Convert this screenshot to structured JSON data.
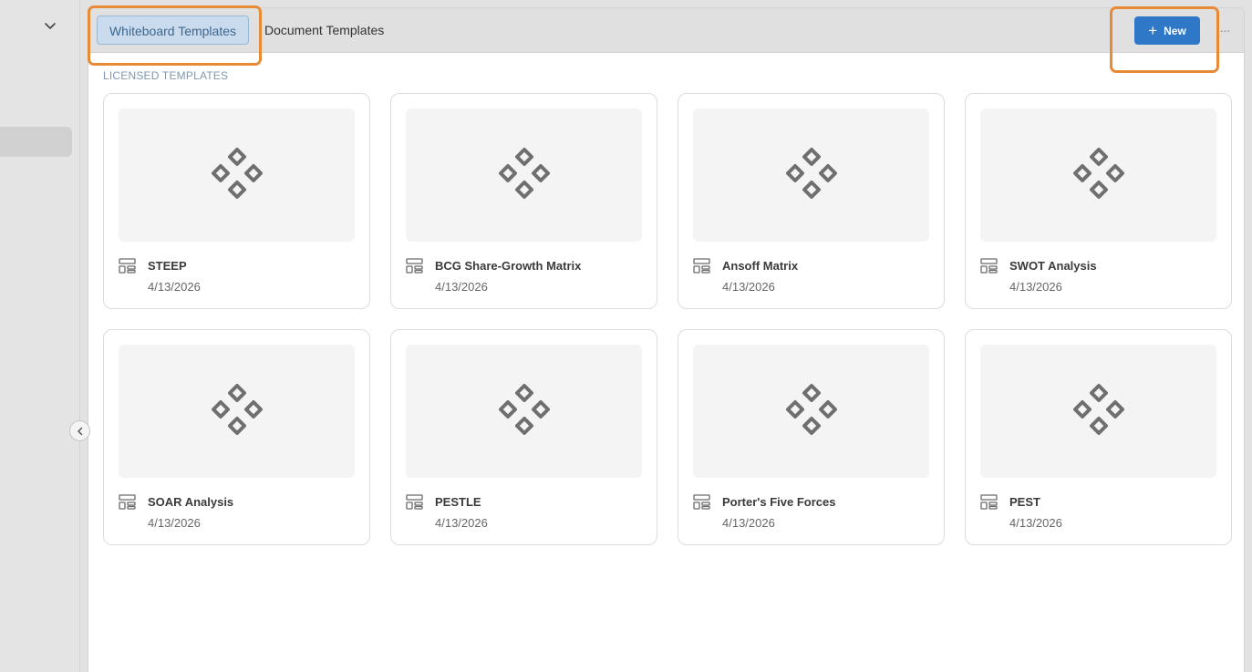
{
  "tabs": [
    {
      "label": "Whiteboard Templates",
      "active": true
    },
    {
      "label": "Document Templates",
      "active": false
    }
  ],
  "toolbar": {
    "new_label": "New",
    "new_icon": "plus-icon",
    "more_icon": "ellipsis-icon",
    "more_label": "···"
  },
  "section": {
    "label": "LICENSED TEMPLATES"
  },
  "templates": [
    {
      "title": "STEEP",
      "date": "4/13/2026"
    },
    {
      "title": "BCG Share-Growth Matrix",
      "date": "4/13/2026"
    },
    {
      "title": "Ansoff Matrix",
      "date": "4/13/2026"
    },
    {
      "title": "SWOT Analysis",
      "date": "4/13/2026"
    },
    {
      "title": "SOAR Analysis",
      "date": "4/13/2026"
    },
    {
      "title": "PESTLE",
      "date": "4/13/2026"
    },
    {
      "title": "Porter's Five Forces",
      "date": "4/13/2026"
    },
    {
      "title": "PEST",
      "date": "4/13/2026"
    }
  ],
  "icons": {
    "thumbnail": "diamond-cluster-icon",
    "card_type": "layout-template-icon",
    "sidebar_toggle": "chevron-down-icon",
    "collapse": "chevron-left-icon"
  },
  "colors": {
    "accent": "#2f78c7",
    "active_tab_bg": "#c9dbec",
    "active_tab_text": "#3e6790",
    "highlight": "#e98a36"
  }
}
